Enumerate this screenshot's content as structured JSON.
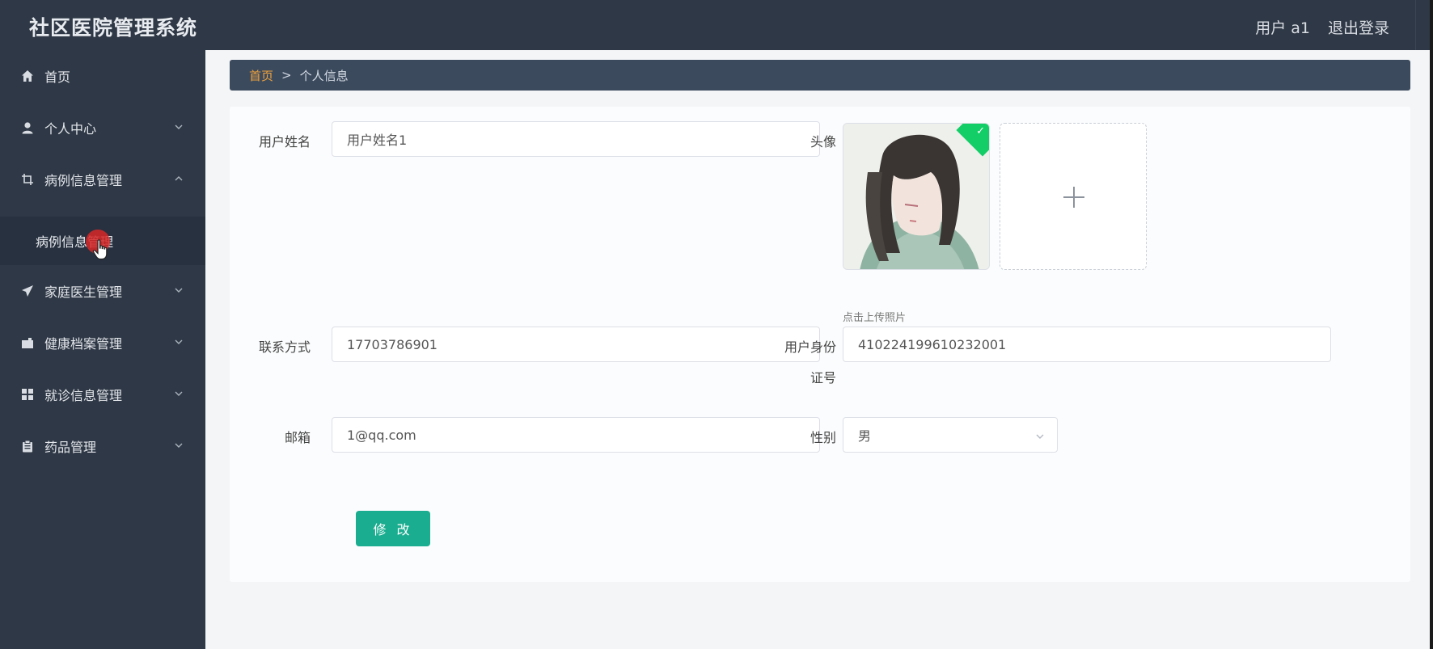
{
  "app": {
    "title": "社区医院管理系统"
  },
  "header": {
    "user_label": "用户 a1",
    "logout_label": "退出登录"
  },
  "sidebar": {
    "items": [
      {
        "label": "首页",
        "icon": "home-icon"
      },
      {
        "label": "个人中心",
        "icon": "user-icon",
        "expanded": false
      },
      {
        "label": "病例信息管理",
        "icon": "crop-icon",
        "expanded": true
      },
      {
        "label": "家庭医生管理",
        "icon": "send-icon",
        "expanded": false
      },
      {
        "label": "健康档案管理",
        "icon": "briefcase-icon",
        "expanded": false
      },
      {
        "label": "就诊信息管理",
        "icon": "grid-icon",
        "expanded": false
      },
      {
        "label": "药品管理",
        "icon": "clipboard-icon",
        "expanded": false
      }
    ],
    "submenu": {
      "label": "病例信息管理"
    }
  },
  "breadcrumb": {
    "home": "首页",
    "separator": ">",
    "current": "个人信息"
  },
  "form": {
    "username": {
      "label": "用户姓名",
      "value": "用户姓名1"
    },
    "avatar": {
      "label": "头像",
      "tip": "点击上传照片"
    },
    "phone": {
      "label": "联系方式",
      "value": "17703786901"
    },
    "idcard": {
      "label_line1": "用户身份",
      "label_line2": "证号",
      "value": "410224199610232001"
    },
    "email": {
      "label": "邮箱",
      "value": "1@qq.com"
    },
    "gender": {
      "label": "性别",
      "value": "男"
    },
    "submit_label": "修 改"
  },
  "colors": {
    "header_bg": "#2f3846",
    "sidebar_bg": "#2f3846",
    "breadcrumb_bg": "#3c4a5e",
    "breadcrumb_home": "#f0a23a",
    "button_bg": "#1aad8f",
    "upload_success": "#13ce66"
  }
}
